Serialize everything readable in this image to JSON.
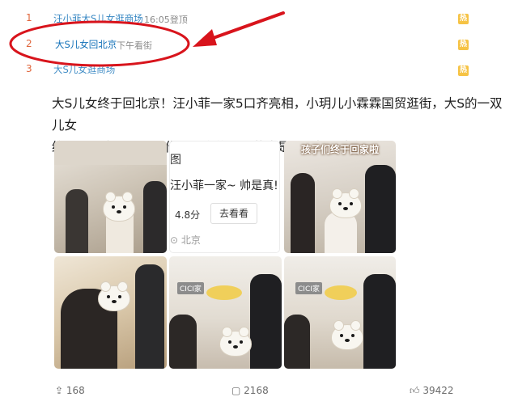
{
  "hot_list": [
    {
      "rank": "1",
      "text": "汪小菲大S儿女逛商场",
      "time": "16:05登顶"
    },
    {
      "rank": "2",
      "text": "大S儿女回北京",
      "time": "下午看街"
    },
    {
      "rank": "3",
      "text": "大S儿女逛商场",
      "time": ""
    }
  ],
  "badge_label": "热",
  "post": {
    "text_line1": "大S儿女终于回北京！汪小菲一家5口齐亮相，小玥儿小霖霖国贸逛街，大S的一双儿女",
    "text_line2": "终于回北京了，证明作为父亲的汪小菲也是真正担起责任了。"
  },
  "video_card": {
    "title_partial": "汪小菲一家~ 帅是真!",
    "rating": "4.8分",
    "go_label": "去看看",
    "location": "北京",
    "fragment": "图"
  },
  "photo_caption": "孩子们终于回家啦",
  "store_sign": "CICI家",
  "actions": {
    "share": "168",
    "comment": "2168",
    "like": "39422"
  },
  "colors": {
    "annotation_red": "#d8141c",
    "link_blue": "#0f6fb7",
    "rank_orange": "#e0663c"
  }
}
